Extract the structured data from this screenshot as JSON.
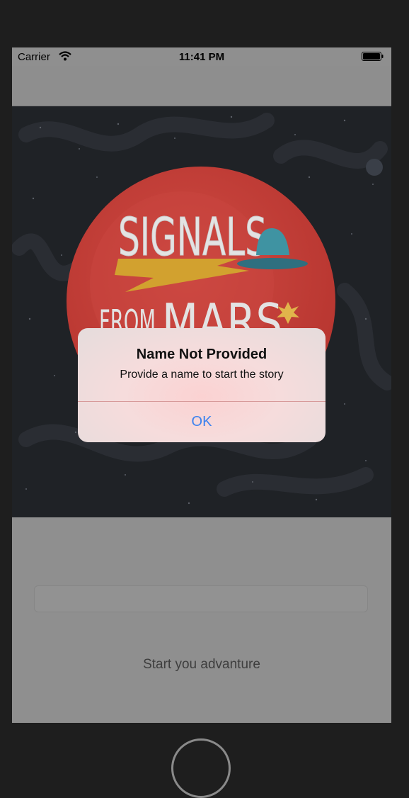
{
  "status_bar": {
    "carrier": "Carrier",
    "time": "11:41 PM",
    "icons": [
      "wifi-icon",
      "battery-icon"
    ]
  },
  "hero": {
    "art_text": [
      "SIGNALS",
      "FROM",
      "MARS"
    ],
    "icons": [
      "planet-icon",
      "ufo-icon",
      "lightning-icon",
      "star-burst-icon"
    ]
  },
  "form": {
    "name_field": {
      "value": "",
      "placeholder": ""
    },
    "start_button_label": "Start you advanture"
  },
  "alert": {
    "title": "Name Not Provided",
    "message": "Provide a name to start the story",
    "ok_label": "OK"
  },
  "colors": {
    "alert_button": "#3b82ef",
    "planet": "#c4413b",
    "hero_bg": "#1f2226"
  }
}
